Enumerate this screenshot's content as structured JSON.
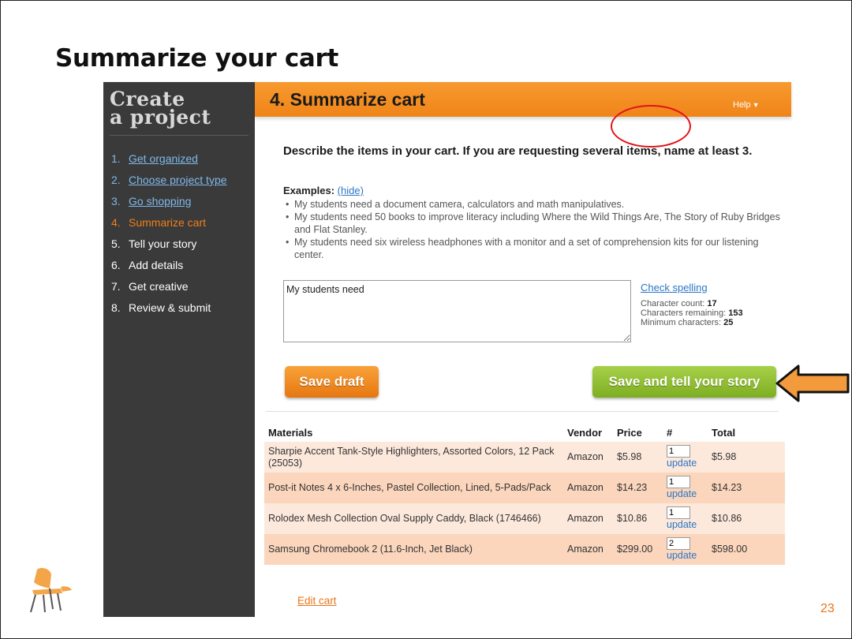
{
  "slide": {
    "title": "Summarize your cart",
    "page_number": "23"
  },
  "sidebar": {
    "title_line1": "Create",
    "title_line2": "a project",
    "steps": [
      {
        "num": "1.",
        "label": "Get organized",
        "state": "link"
      },
      {
        "num": "2.",
        "label": "Choose project type",
        "state": "link"
      },
      {
        "num": "3.",
        "label": "Go shopping",
        "state": "link"
      },
      {
        "num": "4.",
        "label": "Summarize cart",
        "state": "active"
      },
      {
        "num": "5.",
        "label": "Tell your story",
        "state": "plain"
      },
      {
        "num": "6.",
        "label": "Add details",
        "state": "plain"
      },
      {
        "num": "7.",
        "label": "Get creative",
        "state": "plain"
      },
      {
        "num": "8.",
        "label": "Review & submit",
        "state": "plain"
      }
    ]
  },
  "header": {
    "title": "4. Summarize cart",
    "help_label": "Help",
    "color": "#f08419"
  },
  "form": {
    "instructions": "Describe the items in your cart. If you are requesting several items, name at least 3.",
    "examples_label": "Examples:",
    "hide_link": "(hide)",
    "examples": [
      "My students need a document camera, calculators and math manipulatives.",
      "My students need 50 books to improve literacy including Where the Wild Things Are, The Story of Ruby Bridges and Flat Stanley.",
      "My students need six wireless headphones with a monitor and a set of comprehension kits for our listening center."
    ],
    "description_value": "My students need",
    "check_spelling": "Check spelling",
    "char_count_label": "Character count:",
    "char_count": "17",
    "chars_remaining_label": "Characters remaining:",
    "chars_remaining": "153",
    "min_chars_label": "Minimum characters:",
    "min_chars": "25"
  },
  "buttons": {
    "save_draft": "Save draft",
    "save_story": "Save and tell your story"
  },
  "materials": {
    "headers": {
      "materials": "Materials",
      "vendor": "Vendor",
      "price": "Price",
      "qty": "#",
      "total": "Total"
    },
    "update_label": "update",
    "rows": [
      {
        "name": "Sharpie Accent Tank-Style Highlighters, Assorted Colors, 12 Pack (25053)",
        "vendor": "Amazon",
        "price": "$5.98",
        "qty": "1",
        "total": "$5.98"
      },
      {
        "name": "Post-it Notes 4 x 6-Inches, Pastel Collection, Lined, 5-Pads/Pack",
        "vendor": "Amazon",
        "price": "$14.23",
        "qty": "1",
        "total": "$14.23"
      },
      {
        "name": "Rolodex Mesh Collection Oval Supply Caddy, Black (1746466)",
        "vendor": "Amazon",
        "price": "$10.86",
        "qty": "1",
        "total": "$10.86"
      },
      {
        "name": "Samsung Chromebook 2 (11.6-Inch, Jet Black)",
        "vendor": "Amazon",
        "price": "$299.00",
        "qty": "2",
        "total": "$598.00"
      }
    ],
    "edit_cart": "Edit cart"
  },
  "annotations": {
    "help_circle_color": "#e1141a",
    "arrow_color": "#f39a3c"
  },
  "icons": [
    "chair-icon",
    "caret-down-icon",
    "arrow-left-icon"
  ]
}
